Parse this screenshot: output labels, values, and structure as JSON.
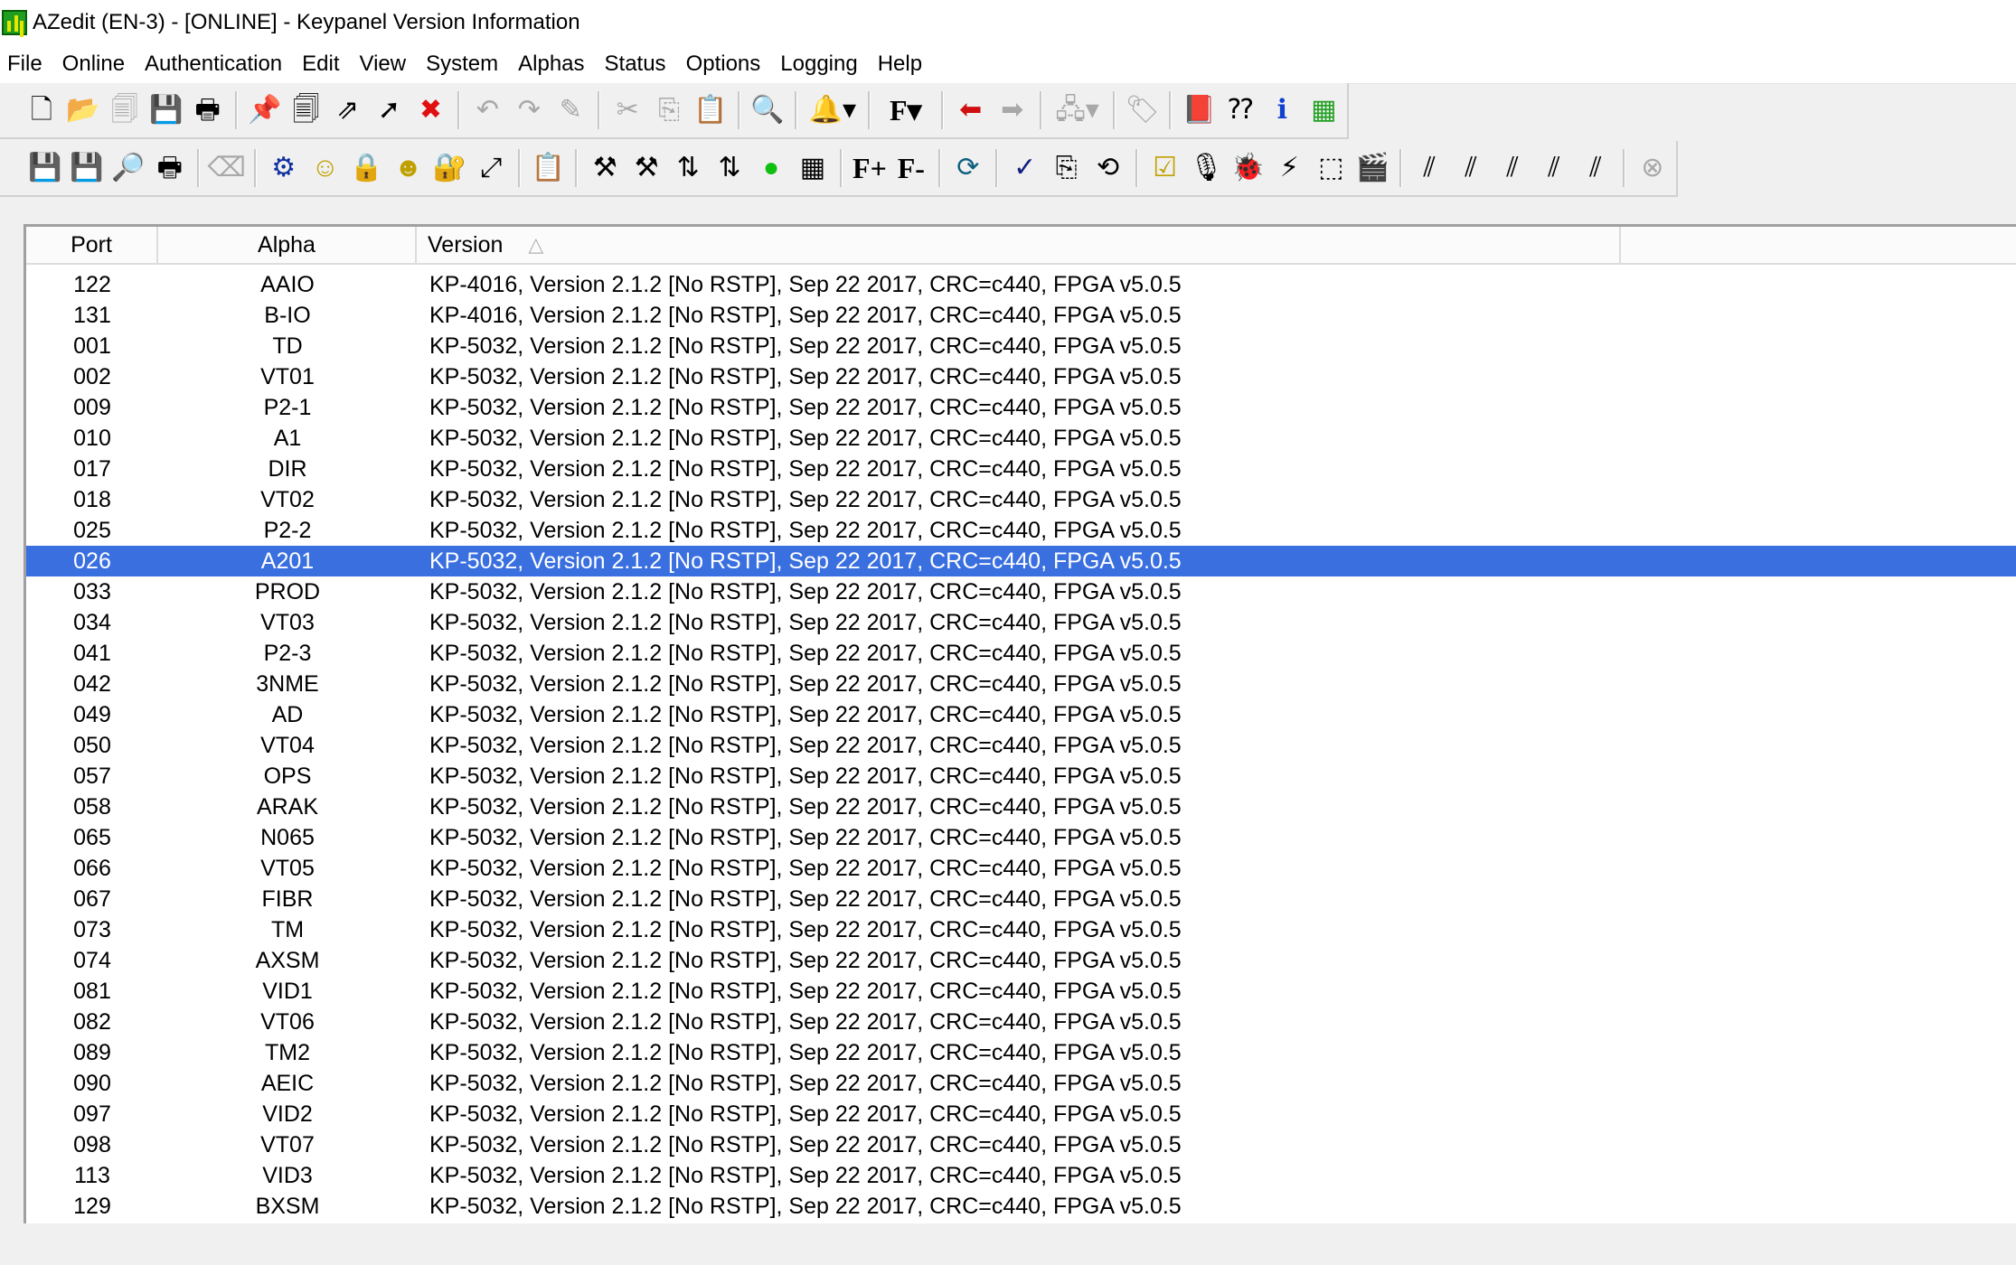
{
  "window": {
    "title": "AZedit (EN-3) - [ONLINE] - Keypanel Version Information"
  },
  "menu": [
    "File",
    "Online",
    "Authentication",
    "Edit",
    "View",
    "System",
    "Alphas",
    "Status",
    "Options",
    "Logging",
    "Help"
  ],
  "toolbar1": [
    {
      "name": "new-file-icon",
      "glyph": "🗋",
      "disabled": false
    },
    {
      "name": "open-folder-icon",
      "glyph": "📂",
      "disabled": false
    },
    {
      "name": "copy-doc-icon",
      "glyph": "🗐",
      "disabled": true
    },
    {
      "name": "save-icon",
      "glyph": "💾",
      "disabled": false
    },
    {
      "name": "print-icon",
      "glyph": "🖶",
      "disabled": false
    },
    {
      "sep": true
    },
    {
      "name": "pin-icon",
      "glyph": "📌",
      "disabled": true
    },
    {
      "name": "documents-icon",
      "glyph": "🗐",
      "disabled": false
    },
    {
      "name": "export-icon",
      "glyph": "⇗",
      "disabled": false
    },
    {
      "name": "arrow-up-right-icon",
      "glyph": "➚",
      "disabled": false
    },
    {
      "name": "red-x-icon",
      "glyph": "✖",
      "disabled": false,
      "color": "#e01010"
    },
    {
      "sep": true
    },
    {
      "name": "undo-icon",
      "glyph": "↶",
      "disabled": true
    },
    {
      "name": "redo-icon",
      "glyph": "↷",
      "disabled": true
    },
    {
      "name": "pencil-icon",
      "glyph": "✎",
      "disabled": true
    },
    {
      "sep": true
    },
    {
      "name": "cut-icon",
      "glyph": "✂",
      "disabled": true
    },
    {
      "name": "copy-icon",
      "glyph": "⎘",
      "disabled": true
    },
    {
      "name": "paste-icon",
      "glyph": "📋",
      "disabled": true
    },
    {
      "sep": true
    },
    {
      "name": "search-icon",
      "glyph": "🔍",
      "disabled": false
    },
    {
      "sep": true
    },
    {
      "name": "devices-dropdown-icon",
      "glyph": "🔔▾",
      "disabled": false,
      "wide": true
    },
    {
      "sep": true
    },
    {
      "name": "font-dropdown-icon",
      "glyph": "F▾",
      "disabled": false,
      "wide": true,
      "text": true
    },
    {
      "sep": true
    },
    {
      "name": "arrow-left-icon",
      "glyph": "⬅",
      "disabled": false,
      "color": "#d01010"
    },
    {
      "name": "arrow-right-icon",
      "glyph": "➡",
      "disabled": true
    },
    {
      "sep": true
    },
    {
      "name": "network-dropdown-icon",
      "glyph": "🖧▾",
      "disabled": true,
      "wide": true
    },
    {
      "sep": true
    },
    {
      "name": "tag-icon",
      "glyph": "🏷",
      "disabled": true
    },
    {
      "sep": true
    },
    {
      "name": "book-icon",
      "glyph": "📕",
      "disabled": false
    },
    {
      "name": "help-pointer-icon",
      "glyph": "⁇",
      "disabled": false
    },
    {
      "name": "info-icon",
      "glyph": "ℹ",
      "disabled": false,
      "color": "#1040d0"
    },
    {
      "name": "matrix-icon",
      "glyph": "▦",
      "disabled": false,
      "color": "#20a020"
    }
  ],
  "toolbar2": [
    {
      "name": "save-green-icon",
      "glyph": "💾",
      "disabled": false
    },
    {
      "name": "save-red-icon",
      "glyph": "💾",
      "disabled": false
    },
    {
      "name": "print-preview-icon",
      "glyph": "🔎",
      "disabled": false
    },
    {
      "name": "printer-icon",
      "glyph": "🖶",
      "disabled": false
    },
    {
      "sep": true
    },
    {
      "name": "eraser-icon",
      "glyph": "⌫",
      "disabled": true
    },
    {
      "sep": true
    },
    {
      "name": "gear-icon",
      "glyph": "⚙",
      "disabled": false,
      "color": "#1030a0"
    },
    {
      "name": "smiley-icon",
      "glyph": "☺",
      "disabled": false,
      "color": "#c0a000"
    },
    {
      "name": "lock-icon",
      "glyph": "🔒",
      "disabled": true
    },
    {
      "name": "group-smiley-icon",
      "glyph": "☻",
      "disabled": false,
      "color": "#c0a000"
    },
    {
      "name": "locked-panel-icon",
      "glyph": "🔐",
      "disabled": false
    },
    {
      "name": "panel-arrow-icon",
      "glyph": "⤢",
      "disabled": false
    },
    {
      "sep": true
    },
    {
      "name": "clipboard-icon",
      "glyph": "📋",
      "disabled": true
    },
    {
      "sep": true
    },
    {
      "name": "tools-icon",
      "glyph": "⚒",
      "disabled": false
    },
    {
      "name": "tools-star-icon",
      "glyph": "⚒",
      "disabled": false
    },
    {
      "name": "swap-arrows-icon",
      "glyph": "⇅",
      "disabled": false
    },
    {
      "name": "swap-arrows-green-icon",
      "glyph": "⇅",
      "disabled": false
    },
    {
      "name": "green-dot-icon",
      "glyph": "●",
      "disabled": false,
      "color": "#10c010"
    },
    {
      "name": "calculator-icon",
      "glyph": "▦",
      "disabled": false
    },
    {
      "sep": true
    },
    {
      "name": "font-plus-icon",
      "glyph": "F+",
      "disabled": false,
      "text": true
    },
    {
      "name": "font-minus-icon",
      "glyph": "F-",
      "disabled": false,
      "text": true
    },
    {
      "sep": true
    },
    {
      "name": "refresh-icon",
      "glyph": "⟳",
      "disabled": false,
      "color": "#106080"
    },
    {
      "sep": true
    },
    {
      "name": "spellcheck-icon",
      "glyph": "✓",
      "disabled": false,
      "color": "#102080"
    },
    {
      "name": "copy-blue-icon",
      "glyph": "⎘",
      "disabled": false
    },
    {
      "name": "sync-icon",
      "glyph": "⟲",
      "disabled": false
    },
    {
      "sep": true
    },
    {
      "name": "checkbox-icon",
      "glyph": "☑",
      "disabled": false,
      "color": "#c0a000"
    },
    {
      "name": "beltpack-icon",
      "glyph": "🎙",
      "disabled": false
    },
    {
      "name": "bug-icon",
      "glyph": "🐞",
      "disabled": false,
      "color": "#b00000"
    },
    {
      "name": "lightning-icon",
      "glyph": "⚡",
      "disabled": false
    },
    {
      "name": "selection-icon",
      "glyph": "⬚",
      "disabled": false
    },
    {
      "name": "slate-icon",
      "glyph": "🎬",
      "disabled": false
    },
    {
      "sep": true
    },
    {
      "name": "trunk-icon",
      "glyph": "⫽",
      "disabled": false
    },
    {
      "name": "trunk-plus-icon",
      "glyph": "⫽",
      "disabled": false
    },
    {
      "name": "trunk-bar-icon",
      "glyph": "⫽",
      "disabled": false
    },
    {
      "name": "trunk-add-icon",
      "glyph": "⫽",
      "disabled": false
    },
    {
      "name": "trunk-tape-icon",
      "glyph": "⫽",
      "disabled": false
    },
    {
      "sep": true
    },
    {
      "name": "close-circle-icon",
      "glyph": "⊗",
      "disabled": true
    }
  ],
  "table": {
    "columns": {
      "port": "Port",
      "alpha": "Alpha",
      "version": "Version"
    },
    "rows": [
      {
        "port": "122",
        "alpha": "AAIO",
        "version": "KP-4016, Version 2.1.2 [No RSTP], Sep 22 2017, CRC=c440, FPGA v5.0.5"
      },
      {
        "port": "131",
        "alpha": "B-IO",
        "version": "KP-4016, Version 2.1.2 [No RSTP], Sep 22 2017, CRC=c440, FPGA v5.0.5"
      },
      {
        "port": "001",
        "alpha": "TD",
        "version": "KP-5032, Version 2.1.2 [No RSTP], Sep 22 2017, CRC=c440, FPGA v5.0.5"
      },
      {
        "port": "002",
        "alpha": "VT01",
        "version": "KP-5032, Version 2.1.2 [No RSTP], Sep 22 2017, CRC=c440, FPGA v5.0.5"
      },
      {
        "port": "009",
        "alpha": "P2-1",
        "version": "KP-5032, Version 2.1.2 [No RSTP], Sep 22 2017, CRC=c440, FPGA v5.0.5"
      },
      {
        "port": "010",
        "alpha": "A1",
        "version": "KP-5032, Version 2.1.2 [No RSTP], Sep 22 2017, CRC=c440, FPGA v5.0.5"
      },
      {
        "port": "017",
        "alpha": "DIR",
        "version": "KP-5032, Version 2.1.2 [No RSTP], Sep 22 2017, CRC=c440, FPGA v5.0.5"
      },
      {
        "port": "018",
        "alpha": "VT02",
        "version": "KP-5032, Version 2.1.2 [No RSTP], Sep 22 2017, CRC=c440, FPGA v5.0.5"
      },
      {
        "port": "025",
        "alpha": "P2-2",
        "version": "KP-5032, Version 2.1.2 [No RSTP], Sep 22 2017, CRC=c440, FPGA v5.0.5"
      },
      {
        "port": "026",
        "alpha": "A201",
        "version": "KP-5032, Version 2.1.2 [No RSTP], Sep 22 2017, CRC=c440, FPGA v5.0.5",
        "selected": true
      },
      {
        "port": "033",
        "alpha": "PROD",
        "version": "KP-5032, Version 2.1.2 [No RSTP], Sep 22 2017, CRC=c440, FPGA v5.0.5"
      },
      {
        "port": "034",
        "alpha": "VT03",
        "version": "KP-5032, Version 2.1.2 [No RSTP], Sep 22 2017, CRC=c440, FPGA v5.0.5"
      },
      {
        "port": "041",
        "alpha": "P2-3",
        "version": "KP-5032, Version 2.1.2 [No RSTP], Sep 22 2017, CRC=c440, FPGA v5.0.5"
      },
      {
        "port": "042",
        "alpha": "3NME",
        "version": "KP-5032, Version 2.1.2 [No RSTP], Sep 22 2017, CRC=c440, FPGA v5.0.5"
      },
      {
        "port": "049",
        "alpha": "AD",
        "version": "KP-5032, Version 2.1.2 [No RSTP], Sep 22 2017, CRC=c440, FPGA v5.0.5"
      },
      {
        "port": "050",
        "alpha": "VT04",
        "version": "KP-5032, Version 2.1.2 [No RSTP], Sep 22 2017, CRC=c440, FPGA v5.0.5"
      },
      {
        "port": "057",
        "alpha": "OPS",
        "version": "KP-5032, Version 2.1.2 [No RSTP], Sep 22 2017, CRC=c440, FPGA v5.0.5"
      },
      {
        "port": "058",
        "alpha": "ARAK",
        "version": "KP-5032, Version 2.1.2 [No RSTP], Sep 22 2017, CRC=c440, FPGA v5.0.5"
      },
      {
        "port": "065",
        "alpha": "N065",
        "version": "KP-5032, Version 2.1.2 [No RSTP], Sep 22 2017, CRC=c440, FPGA v5.0.5"
      },
      {
        "port": "066",
        "alpha": "VT05",
        "version": "KP-5032, Version 2.1.2 [No RSTP], Sep 22 2017, CRC=c440, FPGA v5.0.5"
      },
      {
        "port": "067",
        "alpha": "FIBR",
        "version": "KP-5032, Version 2.1.2 [No RSTP], Sep 22 2017, CRC=c440, FPGA v5.0.5"
      },
      {
        "port": "073",
        "alpha": "TM",
        "version": "KP-5032, Version 2.1.2 [No RSTP], Sep 22 2017, CRC=c440, FPGA v5.0.5"
      },
      {
        "port": "074",
        "alpha": "AXSM",
        "version": "KP-5032, Version 2.1.2 [No RSTP], Sep 22 2017, CRC=c440, FPGA v5.0.5"
      },
      {
        "port": "081",
        "alpha": "VID1",
        "version": "KP-5032, Version 2.1.2 [No RSTP], Sep 22 2017, CRC=c440, FPGA v5.0.5"
      },
      {
        "port": "082",
        "alpha": "VT06",
        "version": "KP-5032, Version 2.1.2 [No RSTP], Sep 22 2017, CRC=c440, FPGA v5.0.5"
      },
      {
        "port": "089",
        "alpha": "TM2",
        "version": "KP-5032, Version 2.1.2 [No RSTP], Sep 22 2017, CRC=c440, FPGA v5.0.5"
      },
      {
        "port": "090",
        "alpha": "AEIC",
        "version": "KP-5032, Version 2.1.2 [No RSTP], Sep 22 2017, CRC=c440, FPGA v5.0.5"
      },
      {
        "port": "097",
        "alpha": "VID2",
        "version": "KP-5032, Version 2.1.2 [No RSTP], Sep 22 2017, CRC=c440, FPGA v5.0.5"
      },
      {
        "port": "098",
        "alpha": "VT07",
        "version": "KP-5032, Version 2.1.2 [No RSTP], Sep 22 2017, CRC=c440, FPGA v5.0.5"
      },
      {
        "port": "113",
        "alpha": "VID3",
        "version": "KP-5032, Version 2.1.2 [No RSTP], Sep 22 2017, CRC=c440, FPGA v5.0.5"
      },
      {
        "port": "129",
        "alpha": "BXSM",
        "version": "KP-5032, Version 2.1.2 [No RSTP], Sep 22 2017, CRC=c440, FPGA v5.0.5"
      }
    ]
  },
  "colors": {
    "selection": "#3a6fe0",
    "disabled_icon": "#a8a8a8"
  }
}
